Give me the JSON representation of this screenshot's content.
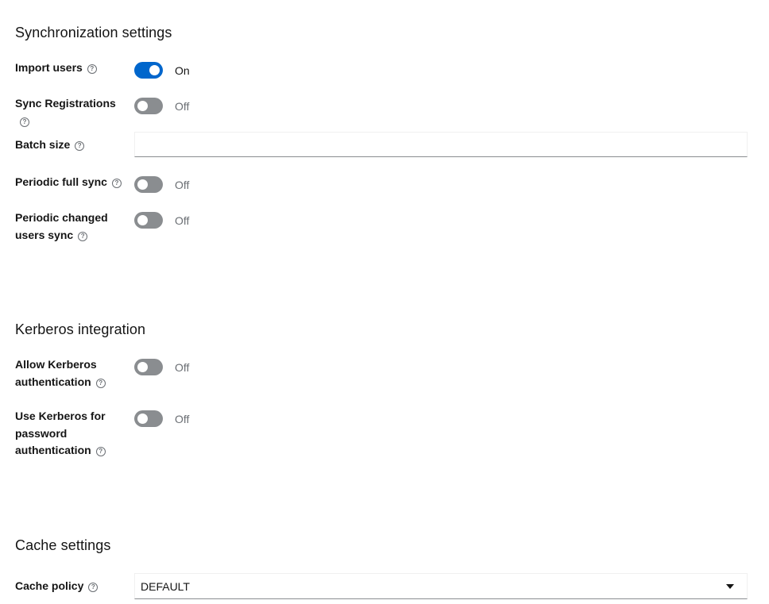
{
  "sync": {
    "title": "Synchronization settings",
    "import_users": {
      "label": "Import users",
      "state": "On"
    },
    "sync_registrations": {
      "label": "Sync Registrations",
      "state": "Off"
    },
    "batch_size": {
      "label": "Batch size",
      "value": ""
    },
    "periodic_full_sync": {
      "label": "Periodic full sync",
      "state": "Off"
    },
    "periodic_changed_sync": {
      "label_line1": "Periodic changed",
      "label_line2": "users sync",
      "state": "Off"
    }
  },
  "kerberos": {
    "title": "Kerberos integration",
    "allow_auth": {
      "label_line1": "Allow Kerberos",
      "label_line2": "authentication",
      "state": "Off"
    },
    "use_for_password": {
      "label_line1": "Use Kerberos for",
      "label_line2": "password",
      "label_line3": "authentication",
      "state": "Off"
    }
  },
  "cache": {
    "title": "Cache settings",
    "cache_policy": {
      "label": "Cache policy",
      "value": "DEFAULT"
    }
  },
  "help_glyph": "?",
  "colors": {
    "accent": "#0066cc",
    "off_track": "#8a8d90",
    "muted_text": "#6a6e73"
  }
}
